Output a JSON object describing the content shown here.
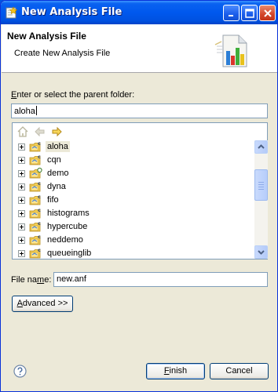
{
  "window": {
    "title": "New Analysis File"
  },
  "header": {
    "title": "New Analysis File",
    "description": "Create New Analysis File"
  },
  "parent_folder": {
    "label_prefix": "E",
    "label_rest": "nter or select the parent folder:",
    "value": "aloha"
  },
  "tree": {
    "toolbar": [
      "home-icon",
      "back-arrow-icon",
      "forward-arrow-icon"
    ],
    "items": [
      {
        "label": "aloha",
        "selected": true,
        "overlay": "c"
      },
      {
        "label": "cqn",
        "overlay": "c"
      },
      {
        "label": "demo",
        "overlay": "ring"
      },
      {
        "label": "dyna",
        "overlay": "c"
      },
      {
        "label": "fifo",
        "overlay": "c"
      },
      {
        "label": "histograms",
        "overlay": "c"
      },
      {
        "label": "hypercube",
        "overlay": "c"
      },
      {
        "label": "neddemo",
        "overlay": "c"
      },
      {
        "label": "queueinglib",
        "overlay": "c"
      }
    ]
  },
  "file_name": {
    "label_prefix": "File na",
    "label_mnemonic": "m",
    "label_rest": "e:",
    "value": "new.anf"
  },
  "buttons": {
    "advanced_mnemonic": "A",
    "advanced_rest": "dvanced >>",
    "finish_mnemonic": "F",
    "finish_rest": "inish",
    "cancel": "Cancel"
  },
  "colors": {
    "title_bar": "#0058ee",
    "dialog_bg": "#ece9d8",
    "selection": "#ece9d8"
  }
}
